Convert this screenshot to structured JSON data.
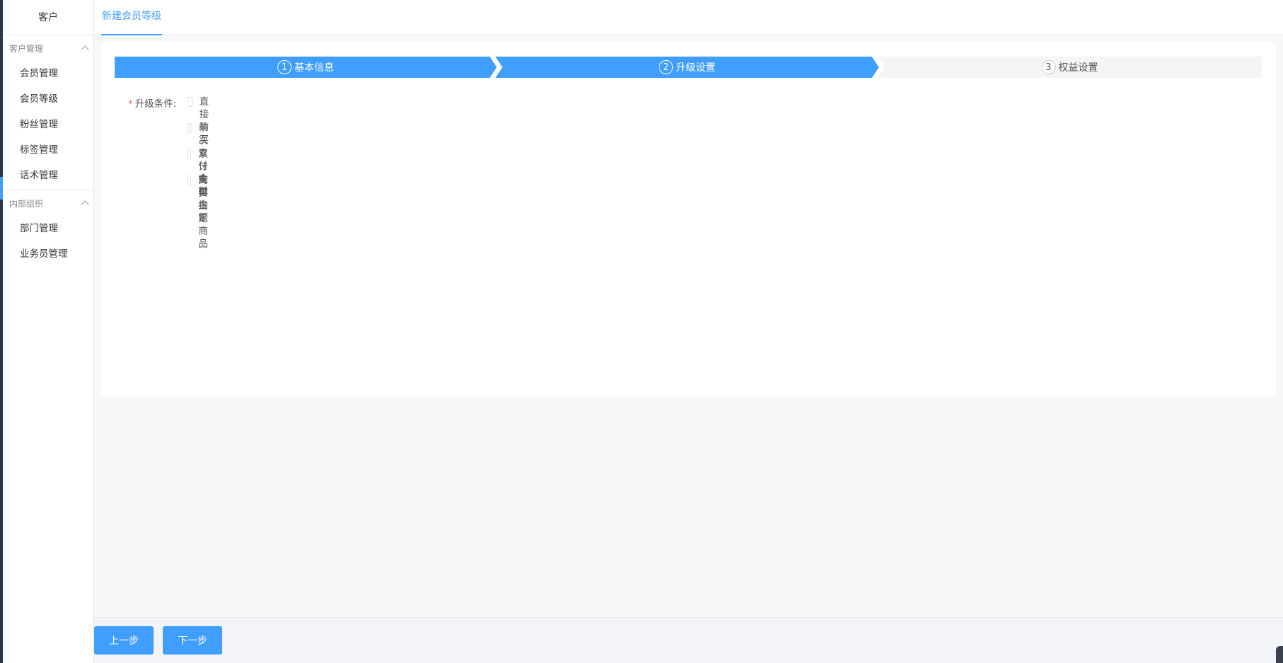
{
  "sidebar": {
    "brand": "客户",
    "groups": [
      {
        "title": "客户管理",
        "items": [
          "会员管理",
          "会员等级",
          "粉丝管理",
          "标签管理",
          "话术管理"
        ]
      },
      {
        "title": "内部组织",
        "items": [
          "部门管理",
          "业务员管理"
        ]
      }
    ]
  },
  "header": {
    "tab": "新建会员等级"
  },
  "steps": [
    {
      "num": "1",
      "label": "基本信息"
    },
    {
      "num": "2",
      "label": "升级设置"
    },
    {
      "num": "3",
      "label": "权益设置"
    }
  ],
  "form": {
    "required_mark": "*",
    "label": "升级条件:",
    "options": [
      "直接购买",
      "单次支付金额",
      "累计支付金额",
      "购买指定商品"
    ]
  },
  "footer": {
    "prev": "上一步",
    "next": "下一步"
  },
  "colors": {
    "primary": "#409eff",
    "sidebar_dark": "#2b3648",
    "required": "#f56c6c"
  }
}
